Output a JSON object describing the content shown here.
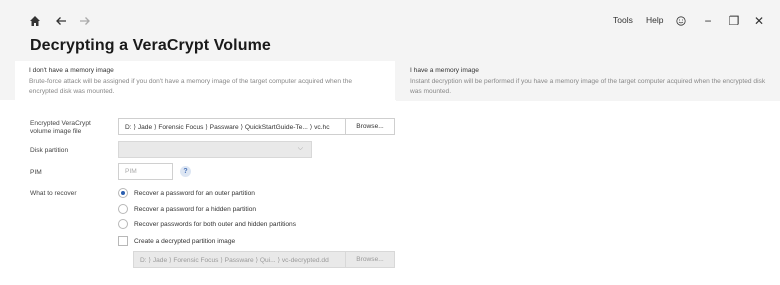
{
  "toolbar": {
    "home_icon": "home-icon",
    "back_icon": "back-arrow-icon",
    "forward_icon": "forward-arrow-icon",
    "menu_tools": "Tools",
    "menu_help": "Help",
    "smile_icon": "smile-icon",
    "minimize": "−",
    "maximize": "❐",
    "close": "✕"
  },
  "page": {
    "title": "Decrypting a VeraCrypt Volume"
  },
  "tabs": [
    {
      "title": "I don't have a memory image",
      "description": "Brute-force attack will be assigned if you don't have a memory image of the target computer acquired when the encrypted disk was mounted.",
      "selected": true
    },
    {
      "title": "I have a memory image",
      "description": "Instant decryption will be performed if you have a memory image of the target computer acquired when the encrypted disk was mounted.",
      "selected": false
    }
  ],
  "form": {
    "file_label": "Encrypted VeraCrypt volume image file",
    "file_value": "D: ⟩ Jade ⟩ Forensic Focus ⟩ Passware ⟩ QuickStartGuide-Te... ⟩ vc.hc",
    "browse_label": "Browse...",
    "disk_label": "Disk partition",
    "disk_value": "",
    "pim_label": "PIM",
    "pim_placeholder": "PIM",
    "pim_help": "?",
    "recover_label": "What to recover",
    "options": [
      {
        "label": "Recover a password for an outer partition",
        "checked": true
      },
      {
        "label": "Recover a password for a hidden partition",
        "checked": false
      },
      {
        "label": "Recover passwords for both outer and hidden partitions",
        "checked": false
      }
    ],
    "create_image_label": "Create a decrypted partition image",
    "create_image_checked": false,
    "output_path": "D: ⟩ Jade ⟩ Forensic Focus ⟩ Passware ⟩ Qui... ⟩ vc-decrypted.dd",
    "output_browse_label": "Browse..."
  },
  "colors": {
    "accent": "#2b5fb0",
    "topbar_bg": "#f4f4f4",
    "disabled_bg": "#e9e9e9"
  }
}
